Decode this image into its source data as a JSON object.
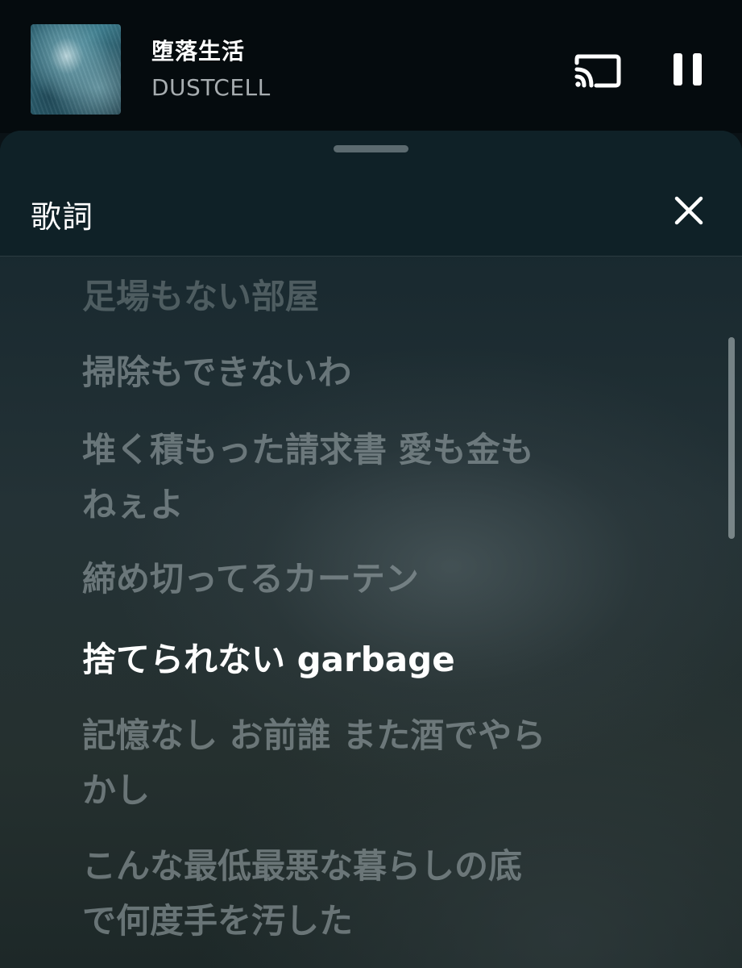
{
  "now_playing": {
    "title": "堕落生活",
    "artist": "DUSTCELL",
    "cast_icon": "cast-icon",
    "pause_icon": "pause-icon"
  },
  "lyrics_sheet": {
    "title": "歌詞",
    "close_icon": "close-icon",
    "active_index": 5,
    "lines": [
      "足場もない部屋",
      "掃除もできないわ",
      "堆く積もった請求書 愛も金も",
      "ねぇよ",
      "締め切ってるカーテン",
      "捨てられない garbage",
      "記憶なし お前誰 また酒でやら",
      "かし",
      "こんな最低最悪な暮らしの底",
      "で何度手を汚した"
    ]
  },
  "colors": {
    "background": "#050b0e",
    "sheet_header": "#0f2127",
    "active_lyric": "#ffffff",
    "inactive_lyric": "#96a2a5"
  }
}
